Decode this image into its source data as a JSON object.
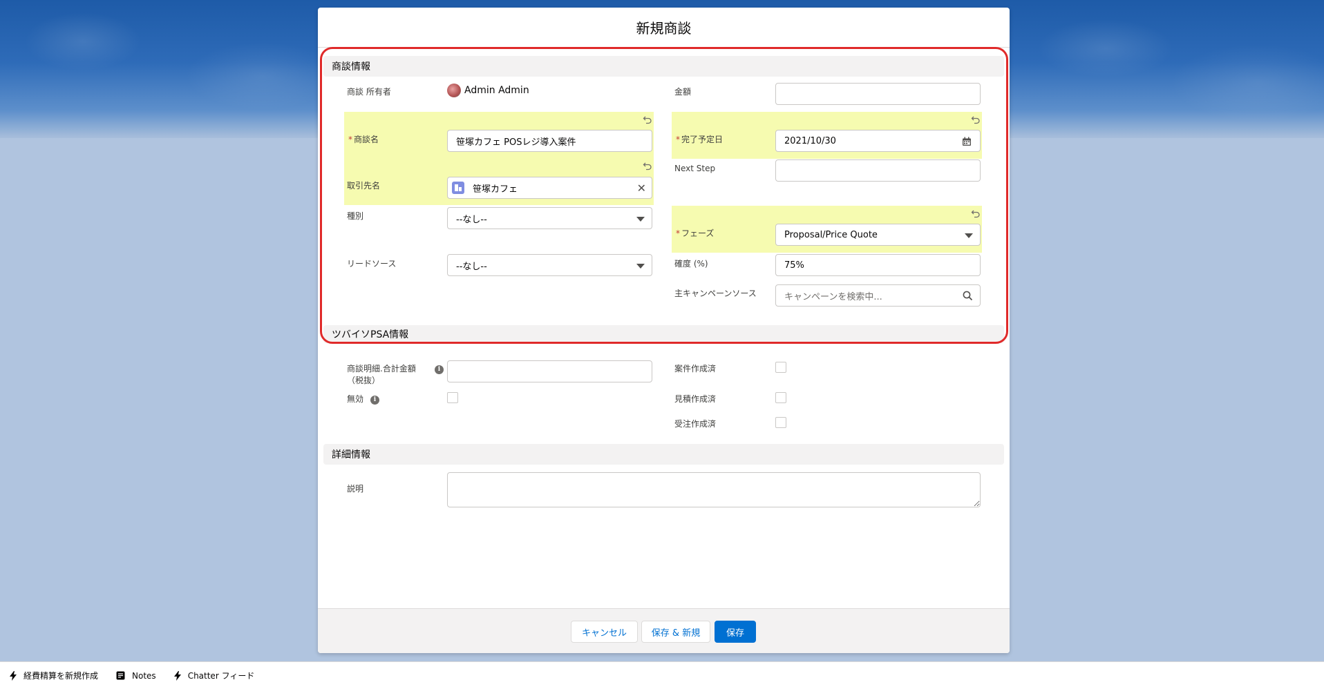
{
  "modal": {
    "title": "新規商談"
  },
  "sections": {
    "opportunity_info": "商談情報",
    "psa_info": "ツバイソPSA情報",
    "details": "詳細情報"
  },
  "fields": {
    "owner": {
      "label": "商談 所有者",
      "value": "Admin Admin"
    },
    "amount": {
      "label": "金額",
      "value": ""
    },
    "opportunity_name": {
      "label": "商談名",
      "value": "笹塚カフェ POSレジ導入案件",
      "required_mark": "*"
    },
    "close_date": {
      "label": "完了予定日",
      "value": "2021/10/30",
      "required_mark": "*"
    },
    "account_name": {
      "label": "取引先名",
      "value": "笹塚カフェ"
    },
    "next_step": {
      "label": "Next Step",
      "value": ""
    },
    "type": {
      "label": "種別",
      "value": "--なし--"
    },
    "stage": {
      "label": "フェーズ",
      "value": "Proposal/Price Quote",
      "required_mark": "*"
    },
    "lead_source": {
      "label": "リードソース",
      "value": "--なし--"
    },
    "probability": {
      "label": "確度 (%)",
      "value": "75%"
    },
    "campaign": {
      "label": "主キャンペーンソース",
      "placeholder": "キャンペーンを検索中..."
    },
    "line_total": {
      "label_line1": "商談明細.合計金額",
      "label_line2": "（税抜）",
      "value": ""
    },
    "invalid": {
      "label": "無効"
    },
    "project_created": {
      "label": "案件作成済"
    },
    "quote_created": {
      "label": "見積作成済"
    },
    "order_created": {
      "label": "受注作成済"
    },
    "description": {
      "label": "説明",
      "value": ""
    }
  },
  "footer": {
    "cancel": "キャンセル",
    "save_new": "保存 & 新規",
    "save": "保存"
  },
  "utility_bar": {
    "items": [
      "経費精算を新規作成",
      "Notes",
      "Chatter フィード"
    ]
  },
  "colors": {
    "brand": "#0070d2",
    "highlight": "#f6fbb0",
    "annotation_outline": "#e02a2a"
  }
}
